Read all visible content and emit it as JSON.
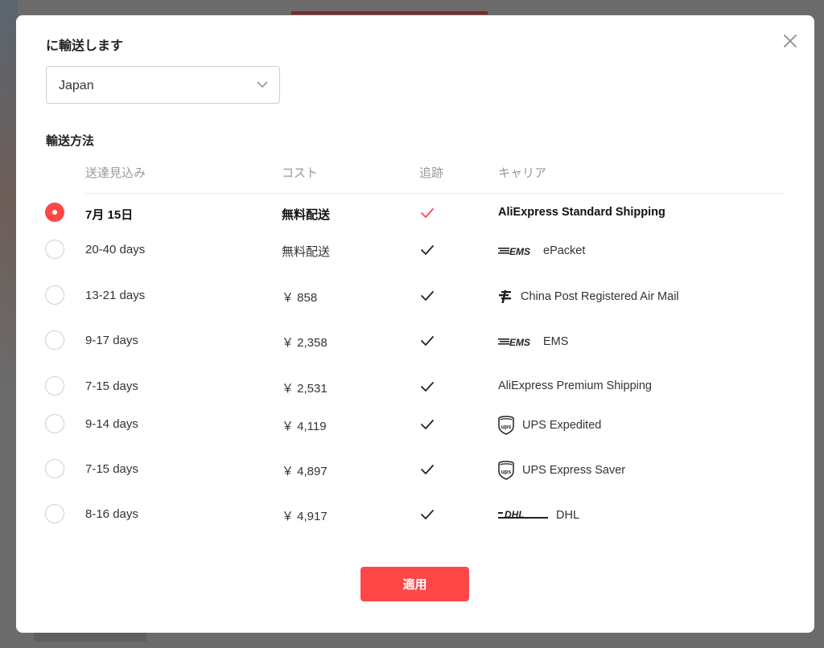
{
  "dialog": {
    "title": "に輸送します",
    "country_select": {
      "value": "Japan"
    },
    "section_title": "輸送方法",
    "columns": [
      "送達見込み",
      "コスト",
      "追跡",
      "キャリア"
    ],
    "accent_color": "#ff4747",
    "rows": [
      {
        "delivery": "7月 15日",
        "cost": "無料配送",
        "tracking": true,
        "carrier": "AliExpress Standard Shipping",
        "logo": "",
        "selected": true
      },
      {
        "delivery": "20-40 days",
        "cost": "無料配送",
        "tracking": true,
        "carrier": "ePacket",
        "logo": "ems-logo",
        "selected": false
      },
      {
        "delivery": "13-21 days",
        "cost": "￥ 858",
        "tracking": true,
        "carrier": "China Post Registered Air Mail",
        "logo": "china-post-logo",
        "selected": false
      },
      {
        "delivery": "9-17 days",
        "cost": "￥ 2,358",
        "tracking": true,
        "carrier": "EMS",
        "logo": "ems-logo",
        "selected": false
      },
      {
        "delivery": "7-15 days",
        "cost": "￥ 2,531",
        "tracking": true,
        "carrier": "AliExpress Premium Shipping",
        "logo": "",
        "selected": false
      },
      {
        "delivery": "9-14 days",
        "cost": "￥ 4,119",
        "tracking": true,
        "carrier": "UPS Expedited",
        "logo": "ups-logo",
        "selected": false
      },
      {
        "delivery": "7-15 days",
        "cost": "￥ 4,897",
        "tracking": true,
        "carrier": "UPS Express Saver",
        "logo": "ups-logo",
        "selected": false
      },
      {
        "delivery": "8-16 days",
        "cost": "￥ 4,917",
        "tracking": true,
        "carrier": "DHL",
        "logo": "dhl-logo",
        "selected": false
      }
    ],
    "apply_label": "適用"
  }
}
